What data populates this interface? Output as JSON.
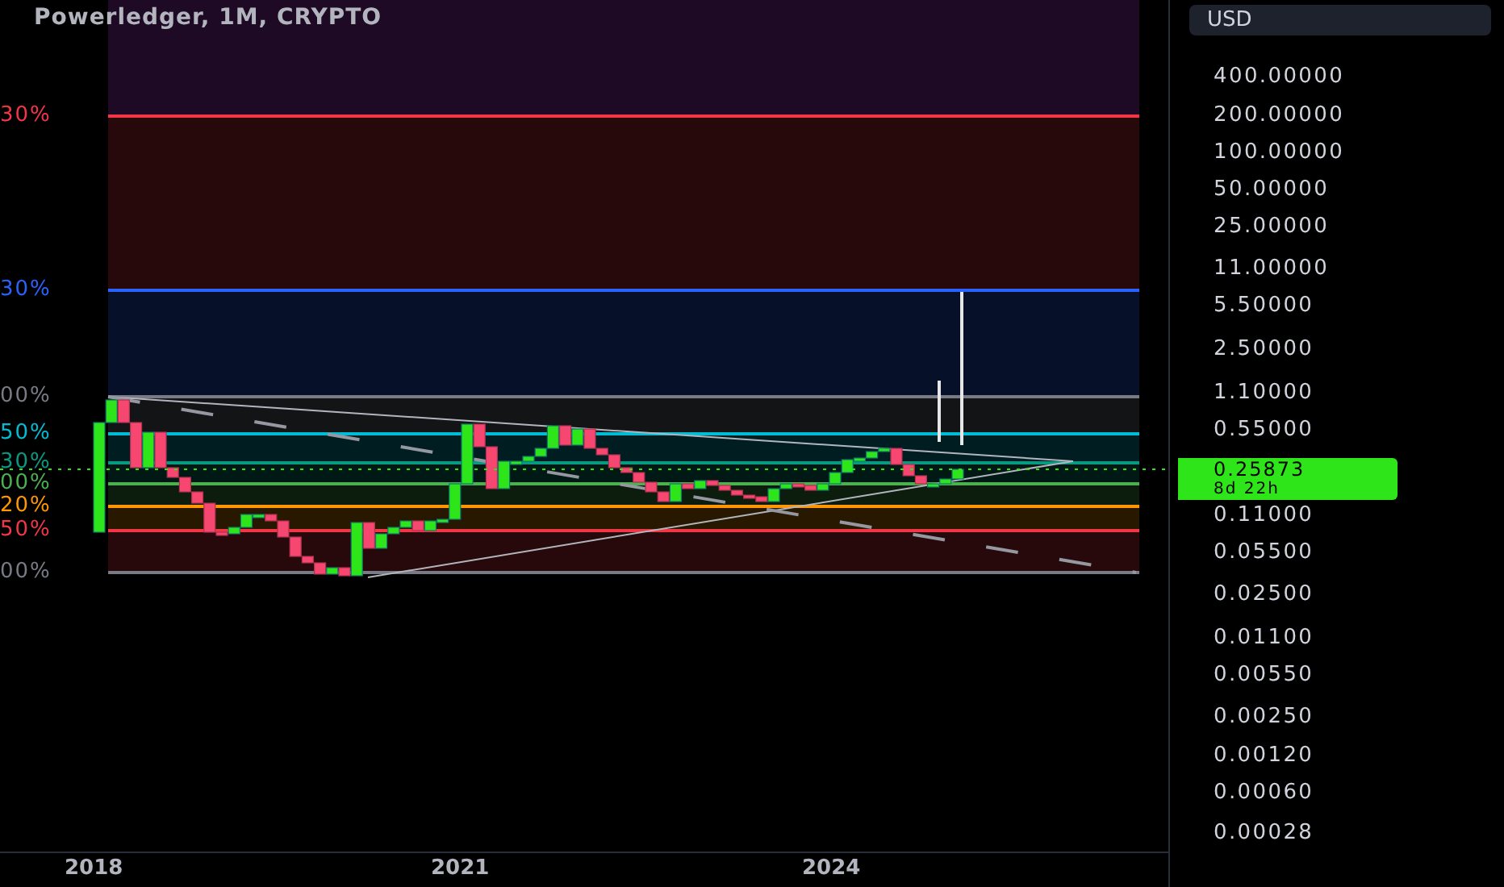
{
  "chart": {
    "title": "Powerledger, 1M, CRYPTO",
    "fib_levels": [
      {
        "label": "30%",
        "color": "#f23645"
      },
      {
        "label": "30%",
        "color": "#2962ff"
      },
      {
        "label": "00%",
        "color": "#787b86"
      },
      {
        "label": "50%",
        "color": "#00bcd4"
      },
      {
        "label": "30%",
        "color": "#089981"
      },
      {
        "label": "00%",
        "color": "#4caf50"
      },
      {
        "label": "20%",
        "color": "#ff9800"
      },
      {
        "label": "50%",
        "color": "#f23645"
      },
      {
        "label": "00%",
        "color": "#787b86"
      }
    ],
    "currency": "USD",
    "price_scale": [
      "400.00000",
      "200.00000",
      "100.00000",
      "50.00000",
      "25.00000",
      "11.00000",
      "5.50000",
      "2.50000",
      "1.10000",
      "0.55000",
      "0.11000",
      "0.05500",
      "0.02500",
      "0.01100",
      "0.00550",
      "0.00250",
      "0.00120",
      "0.00060",
      "0.00028"
    ],
    "last_price": {
      "value": "0.25873",
      "countdown": "8d 22h"
    },
    "time_axis": [
      "2018",
      "2021",
      "2024"
    ]
  }
}
